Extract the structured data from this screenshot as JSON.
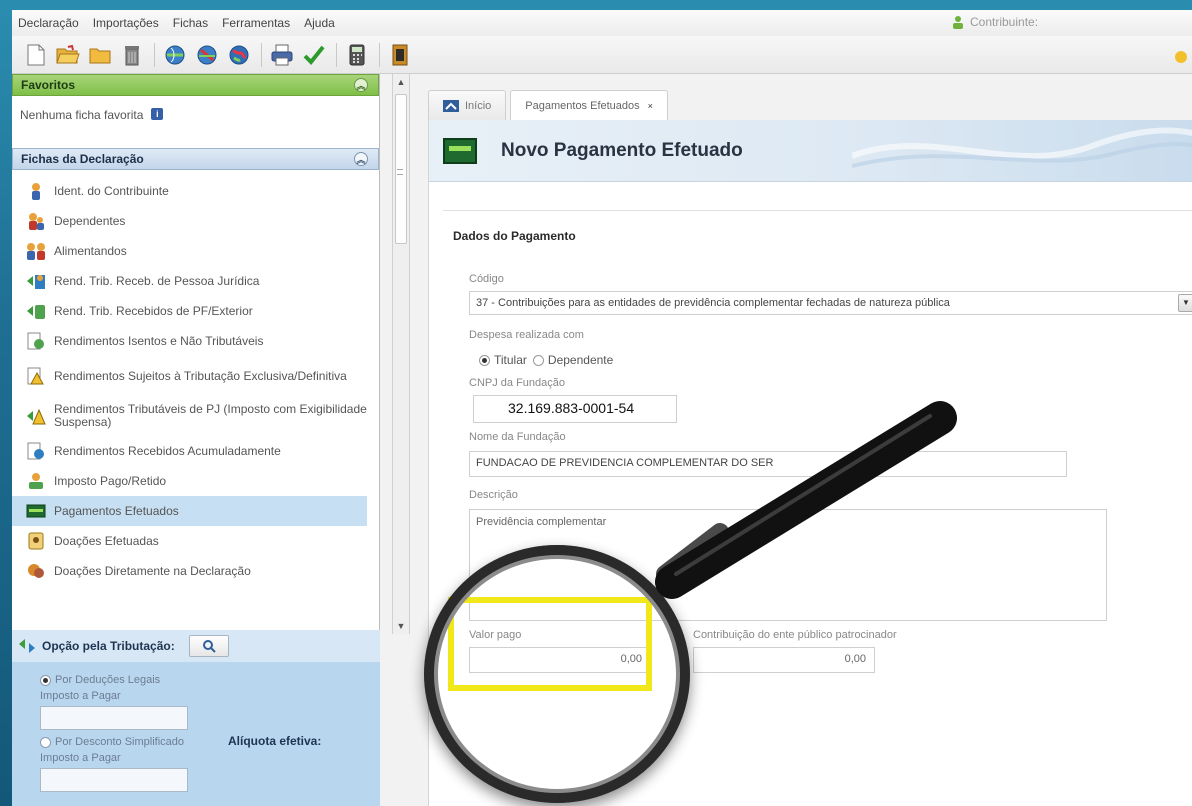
{
  "menu": {
    "items": [
      "Declaração",
      "Importações",
      "Fichas",
      "Ferramentas",
      "Ajuda"
    ],
    "user_label": "Contribuinte:"
  },
  "toolbar": {
    "icons": [
      "new-document-icon",
      "open-folder-icon",
      "folder-icon",
      "trash-icon",
      "globe-send-icon",
      "globe-receive-icon",
      "globe-world-icon",
      "printer-icon",
      "check-icon",
      "calculator-icon",
      "book-icon"
    ]
  },
  "favoritos": {
    "title": "Favoritos",
    "empty_text": "Nenhuma ficha favorita"
  },
  "fichas": {
    "title": "Fichas da Declaração",
    "items": [
      {
        "label": "Ident. do Contribuinte",
        "icon": "person-icon"
      },
      {
        "label": "Dependentes",
        "icon": "dependents-icon"
      },
      {
        "label": "Alimentandos",
        "icon": "alimentandos-icon"
      },
      {
        "label": "Rend. Trib. Receb. de Pessoa Jurídica",
        "icon": "money-arrow-icon"
      },
      {
        "label": "Rend. Trib. Recebidos de PF/Exterior",
        "icon": "money-arrow-icon"
      },
      {
        "label": "Rendimentos Isentos e Não Tributáveis",
        "icon": "document-green-icon"
      },
      {
        "label": "Rendimentos Sujeitos à Tributação Exclusiva/Definitiva",
        "icon": "warning-document-icon"
      },
      {
        "label": "Rendimentos Tributáveis de PJ (Imposto com Exigibilidade Suspensa)",
        "icon": "money-warning-icon"
      },
      {
        "label": "Rendimentos Recebidos Acumuladamente",
        "icon": "document-blue-icon"
      },
      {
        "label": "Imposto Pago/Retido",
        "icon": "tax-person-icon"
      },
      {
        "label": "Pagamentos Efetuados",
        "icon": "card-icon"
      },
      {
        "label": "Doações Efetuadas",
        "icon": "donation-icon"
      },
      {
        "label": "Doações Diretamente na Declaração",
        "icon": "donation-direct-icon"
      }
    ],
    "selected_index": 10
  },
  "opcao": {
    "title": "Opção pela Tributação:",
    "deducoes_label": "Por Deduções Legais",
    "imposto_label_1": "Imposto a Pagar",
    "aliquota_label": "Alíquota efetiva:",
    "desconto_label": "Por Desconto Simplificado",
    "imposto_label_2": "Imposto a Pagar"
  },
  "tabs": [
    {
      "label": "Início"
    },
    {
      "label": "Pagamentos Efetuados",
      "close": "×"
    }
  ],
  "form": {
    "banner_title": "Novo Pagamento Efetuado",
    "section_title": "Dados do Pagamento",
    "codigo_label": "Código",
    "codigo_value": "37 - Contribuições para as entidades de previdência complementar fechadas de natureza pública",
    "despesa_label": "Despesa realizada com",
    "titular_label": "Titular",
    "dependente_label": "Dependente",
    "cnpj_label": "CNPJ da Fundação",
    "cnpj_value": "32.169.883-0001-54",
    "nome_label": "Nome da Fundação",
    "nome_value": "FUNDACAO DE PREVIDENCIA COMPLEMENTAR DO SER",
    "descricao_label": "Descrição",
    "descricao_value": "Previdência complementar",
    "valor_label": "Valor pago",
    "valor_value": "0,00",
    "contrib_label": "Contribuição do ente público patrocinador",
    "contrib_value": "0,00"
  },
  "colors": {
    "favoritos_head": "#7fbf48",
    "selected_row": "#c7dff2",
    "highlight": "#f0e81a",
    "background": "#1f6f93"
  }
}
